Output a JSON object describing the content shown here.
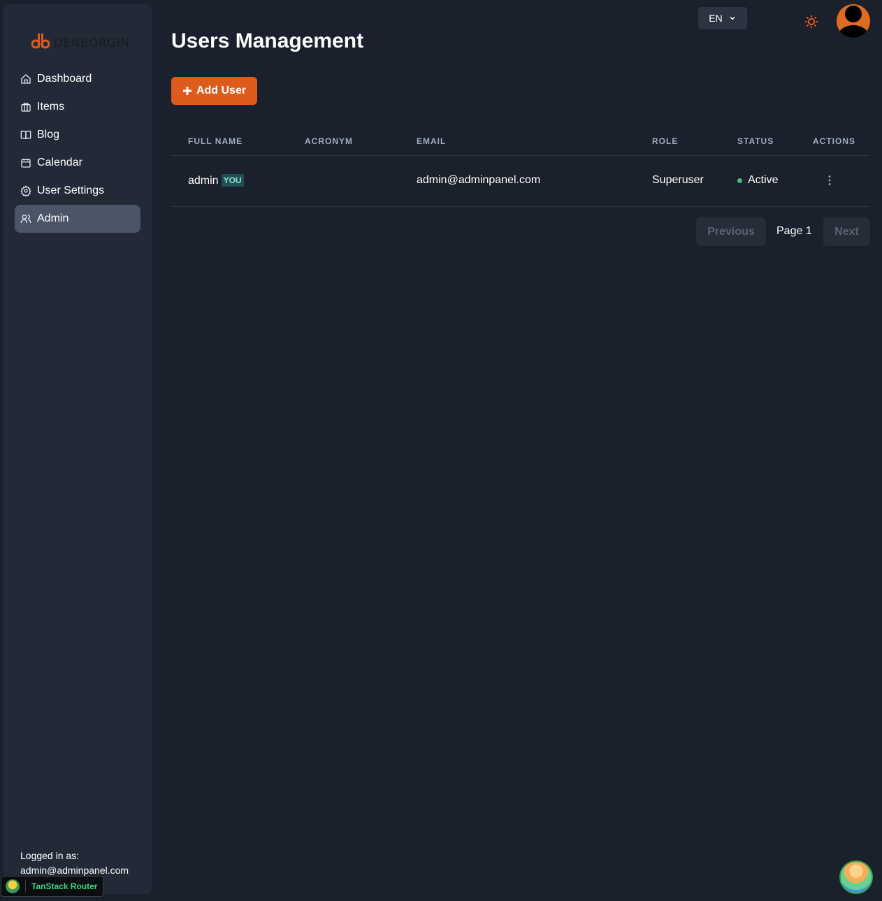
{
  "brand": {
    "name": "DENBORGIN",
    "accent": "#dd5b1c"
  },
  "sidebar": {
    "items": [
      {
        "label": "Dashboard",
        "icon": "home-icon"
      },
      {
        "label": "Items",
        "icon": "briefcase-icon"
      },
      {
        "label": "Blog",
        "icon": "book-icon"
      },
      {
        "label": "Calendar",
        "icon": "calendar-icon"
      },
      {
        "label": "User Settings",
        "icon": "gear-icon"
      },
      {
        "label": "Admin",
        "icon": "users-icon",
        "active": true
      }
    ],
    "logged_in_label": "Logged in as:",
    "logged_in_email": "admin@adminpanel.com"
  },
  "header": {
    "language": "EN",
    "theme_icon": "sun-icon",
    "avatar_icon": "user-avatar-icon"
  },
  "main": {
    "title": "Users Management",
    "add_button": "Add User",
    "columns": [
      "FULL NAME",
      "ACRONYM",
      "EMAIL",
      "ROLE",
      "STATUS",
      "ACTIONS"
    ],
    "rows": [
      {
        "full_name": "admin",
        "badge": "YOU",
        "acronym": "",
        "email": "admin@adminpanel.com",
        "role": "Superuser",
        "status": "Active",
        "status_color": "#48bb78"
      }
    ],
    "pagination": {
      "previous": "Previous",
      "page": "Page 1",
      "next": "Next"
    }
  },
  "devtools": {
    "label": "TanStack Router"
  }
}
